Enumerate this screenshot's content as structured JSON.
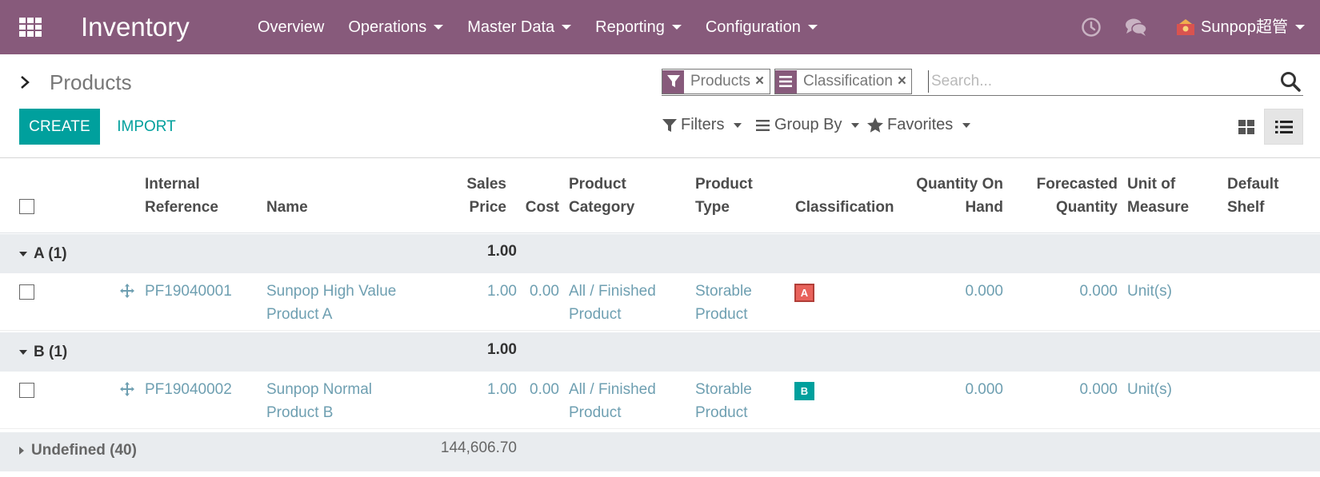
{
  "navbar": {
    "app_name": "Inventory",
    "menu": [
      {
        "label": "Overview",
        "dropdown": false
      },
      {
        "label": "Operations",
        "dropdown": true
      },
      {
        "label": "Master Data",
        "dropdown": true
      },
      {
        "label": "Reporting",
        "dropdown": true
      },
      {
        "label": "Configuration",
        "dropdown": true
      }
    ],
    "activity_icon": "clock-icon",
    "discuss_icon": "chat-icon",
    "user_name": "Sunpop超管",
    "color": "#875a7b"
  },
  "control_panel": {
    "breadcrumb": "Products",
    "create_label": "CREATE",
    "import_label": "IMPORT",
    "search": {
      "facets": [
        {
          "type": "filter",
          "icon": "funnel-icon",
          "label": "Products"
        },
        {
          "type": "groupby",
          "icon": "list-icon",
          "label": "Classification"
        }
      ],
      "placeholder": "Search..."
    },
    "filters_label": "Filters",
    "groupby_label": "Group By",
    "favorites_label": "Favorites",
    "accent_color": "#00a09d"
  },
  "table": {
    "columns": {
      "internal_reference": [
        "Internal",
        "Reference"
      ],
      "name": "Name",
      "sales_price": [
        "Sales",
        "Price"
      ],
      "cost": "Cost",
      "product_category": [
        "Product",
        "Category"
      ],
      "product_type": [
        "Product",
        "Type"
      ],
      "classification": "Classification",
      "quantity_on_hand": [
        "Quantity On",
        "Hand"
      ],
      "forecasted_quantity": [
        "Forecasted",
        "Quantity"
      ],
      "unit_of_measure": [
        "Unit of",
        "Measure"
      ],
      "default_shelf": [
        "Default",
        "Shelf"
      ]
    },
    "groups": [
      {
        "label": "A (1)",
        "sales_price_sum": "1.00",
        "rows": [
          {
            "internal_reference": "PF19040001",
            "name": [
              "Sunpop High Value",
              "Product A"
            ],
            "sales_price": "1.00",
            "cost": "0.00",
            "product_category": [
              "All / Finished",
              "Product"
            ],
            "product_type": [
              "Storable",
              "Product"
            ],
            "classification": "A",
            "quantity_on_hand": "0.000",
            "forecasted_quantity": "0.000",
            "unit_of_measure": "Unit(s)"
          }
        ]
      },
      {
        "label": "B (1)",
        "sales_price_sum": "1.00",
        "rows": [
          {
            "internal_reference": "PF19040002",
            "name": [
              "Sunpop Normal",
              "Product B"
            ],
            "sales_price": "1.00",
            "cost": "0.00",
            "product_category": [
              "All / Finished",
              "Product"
            ],
            "product_type": [
              "Storable",
              "Product"
            ],
            "classification": "B",
            "quantity_on_hand": "0.000",
            "forecasted_quantity": "0.000",
            "unit_of_measure": "Unit(s)"
          }
        ]
      },
      {
        "label": "Undefined (40)",
        "sales_price_sum": "144,606.70",
        "collapsed": true
      }
    ]
  }
}
